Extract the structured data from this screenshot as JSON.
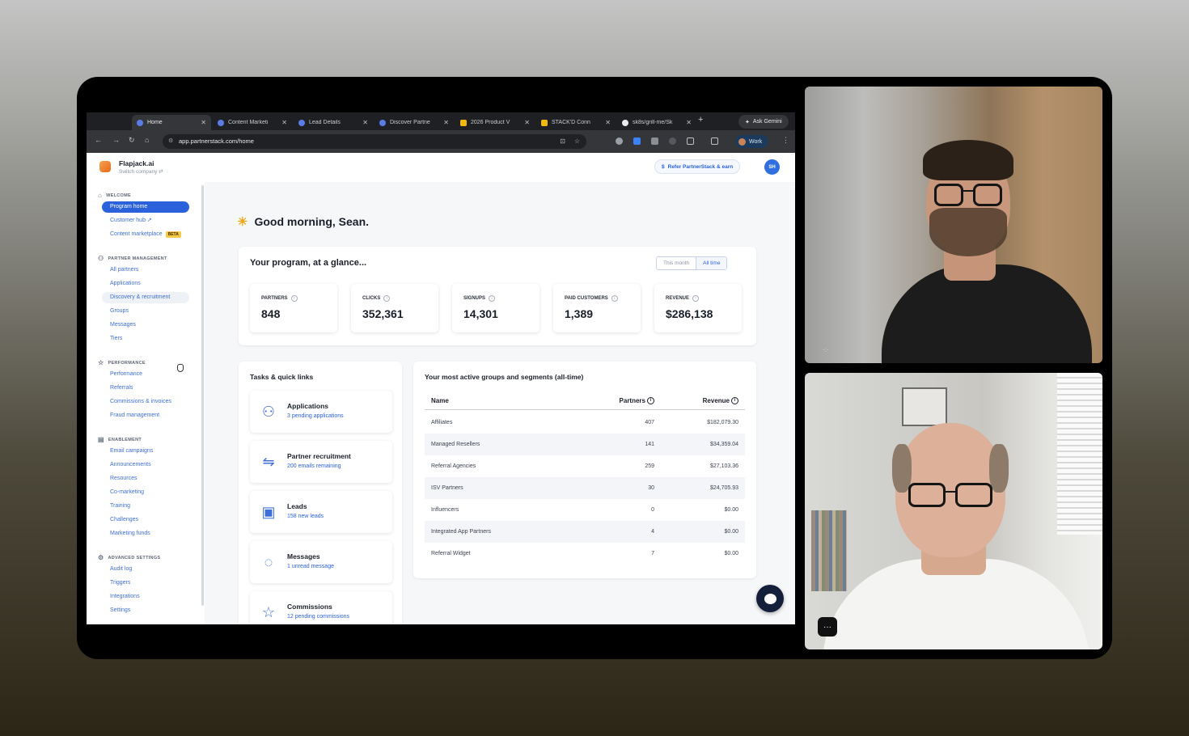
{
  "browser": {
    "tabs": [
      {
        "title": "Home",
        "color": "#5b7be6"
      },
      {
        "title": "Content Marketi",
        "color": "#5b7be6"
      },
      {
        "title": "Lead Details",
        "color": "#5b7be6"
      },
      {
        "title": "Discover Partne",
        "color": "#5b7be6"
      },
      {
        "title": "2026 Product V",
        "color": "#f2b807"
      },
      {
        "title": "STACK'D Conn",
        "color": "#f2b807"
      },
      {
        "title": "sk8s/grill-me/Sk",
        "color": "#e8eaed"
      }
    ],
    "new_tab": "+",
    "ask_gemini": "Ask Gemini",
    "url": "app.partnerstack.com/home",
    "profile": "Work"
  },
  "app": {
    "company": "Flapjack.ai",
    "switch_company": "Switch company ⇄",
    "refer": "Refer PartnerStack & earn",
    "avatar_initials": "SH"
  },
  "sidebar": {
    "sections": [
      {
        "title": "WELCOME",
        "items": [
          "Program home",
          "Customer hub",
          "Content marketplace"
        ]
      },
      {
        "title": "PARTNER MANAGEMENT",
        "items": [
          "All partners",
          "Applications",
          "Discovery & recruitment",
          "Groups",
          "Messages",
          "Tiers"
        ]
      },
      {
        "title": "PERFORMANCE",
        "items": [
          "Performance",
          "Referrals",
          "Commissions & invoices",
          "Fraud management"
        ]
      },
      {
        "title": "ENABLEMENT",
        "items": [
          "Email campaigns",
          "Announcements",
          "Resources",
          "Co-marketing",
          "Training",
          "Challenges",
          "Marketing funds"
        ]
      },
      {
        "title": "ADVANCED SETTINGS",
        "items": [
          "Audit log",
          "Triggers",
          "Integrations",
          "Settings"
        ]
      }
    ],
    "beta_badge": "BETA"
  },
  "main": {
    "greeting": "Good morning, Sean.",
    "glance_title": "Your program, at a glance...",
    "range_options": [
      "This month",
      "All time"
    ],
    "stats": [
      {
        "label": "PARTNERS",
        "value": "848"
      },
      {
        "label": "CLICKS",
        "value": "352,361"
      },
      {
        "label": "SIGNUPS",
        "value": "14,301"
      },
      {
        "label": "PAID CUSTOMERS",
        "value": "1,389"
      },
      {
        "label": "REVENUE",
        "value": "$286,138"
      }
    ],
    "tasks_title": "Tasks & quick links",
    "tasks": [
      {
        "title": "Applications",
        "sub": "3 pending applications",
        "icon": "add-user-icon"
      },
      {
        "title": "Partner recruitment",
        "sub": "200 emails remaining",
        "icon": "handshake-icon"
      },
      {
        "title": "Leads",
        "sub": "158 new leads",
        "icon": "id-card-icon"
      },
      {
        "title": "Messages",
        "sub": "1 unread message",
        "icon": "chat-icon"
      },
      {
        "title": "Commissions",
        "sub": "12 pending commissions",
        "icon": "star-icon"
      }
    ],
    "groups_title": "Your most active groups and segments (all-time)",
    "groups_headers": {
      "name": "Name",
      "partners": "Partners",
      "revenue": "Revenue"
    },
    "groups_rows": [
      {
        "name": "Affiliates",
        "partners": "407",
        "revenue": "$182,079.30"
      },
      {
        "name": "Managed Resellers",
        "partners": "141",
        "revenue": "$34,359.04"
      },
      {
        "name": "Referral Agencies",
        "partners": "259",
        "revenue": "$27,103.36"
      },
      {
        "name": "ISV Partners",
        "partners": "30",
        "revenue": "$24,705.93"
      },
      {
        "name": "Influencers",
        "partners": "0",
        "revenue": "$0.00"
      },
      {
        "name": "Integrated App Partners",
        "partners": "4",
        "revenue": "$0.00"
      },
      {
        "name": "Referral Widget",
        "partners": "7",
        "revenue": "$0.00"
      }
    ]
  },
  "video": {
    "more_button": "···"
  }
}
